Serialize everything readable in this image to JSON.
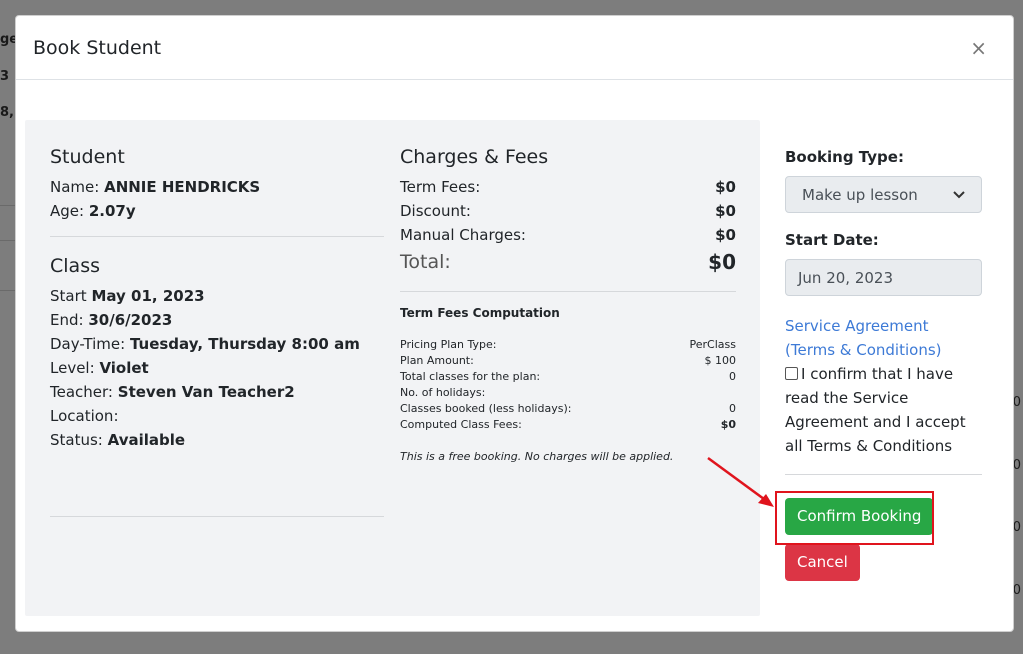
{
  "background": {
    "fragments": [
      "ge",
      "3",
      "8,"
    ],
    "right_fragments": [
      "0",
      "0",
      "0",
      "0"
    ]
  },
  "modal": {
    "title": "Book Student",
    "close_label": "×"
  },
  "student": {
    "heading": "Student",
    "name_label": "Name:",
    "name_value": "ANNIE HENDRICKS",
    "age_label": "Age:",
    "age_value": "2.07y"
  },
  "class": {
    "heading": "Class",
    "start_label": "Start",
    "start_value": "May 01, 2023",
    "end_label": "End:",
    "end_value": "30/6/2023",
    "daytime_label": "Day-Time:",
    "daytime_value": "Tuesday, Thursday 8:00 am",
    "level_label": "Level:",
    "level_value": "Violet",
    "teacher_label": "Teacher:",
    "teacher_value": "Steven Van Teacher2",
    "location_label": "Location:",
    "location_value": "",
    "status_label": "Status:",
    "status_value": "Available"
  },
  "charges": {
    "heading": "Charges & Fees",
    "rows": [
      {
        "label": "Term Fees:",
        "value": "$0"
      },
      {
        "label": "Discount:",
        "value": "$0"
      },
      {
        "label": "Manual Charges:",
        "value": "$0"
      }
    ],
    "total_label": "Total:",
    "total_value": "$0"
  },
  "computation": {
    "heading": "Term Fees Computation",
    "rows": [
      {
        "label": "Pricing Plan Type:",
        "value": "PerClass"
      },
      {
        "label": "Plan Amount:",
        "value": "$ 100"
      },
      {
        "label": "Total classes for the plan:",
        "value": "0"
      },
      {
        "label": "No. of holidays:",
        "value": ""
      },
      {
        "label": "Classes booked (less holidays):",
        "value": "0"
      },
      {
        "label": "Computed Class Fees:",
        "value": "$0"
      }
    ],
    "note": "This is a free booking. No charges will be applied."
  },
  "form": {
    "booking_type_label": "Booking Type:",
    "booking_type_value": "Make up lesson",
    "start_date_label": "Start Date:",
    "start_date_value": "Jun 20, 2023",
    "agreement_link": "Service Agreement (Terms & Conditions)",
    "confirm_text": "I confirm that I have read the Service Agreement and I accept all Terms & Conditions",
    "confirm_button": "Confirm Booking",
    "cancel_button": "Cancel"
  },
  "colors": {
    "confirm": "#28a745",
    "cancel": "#dc3545",
    "highlight": "#e0141d",
    "link": "#3d7ad6"
  }
}
